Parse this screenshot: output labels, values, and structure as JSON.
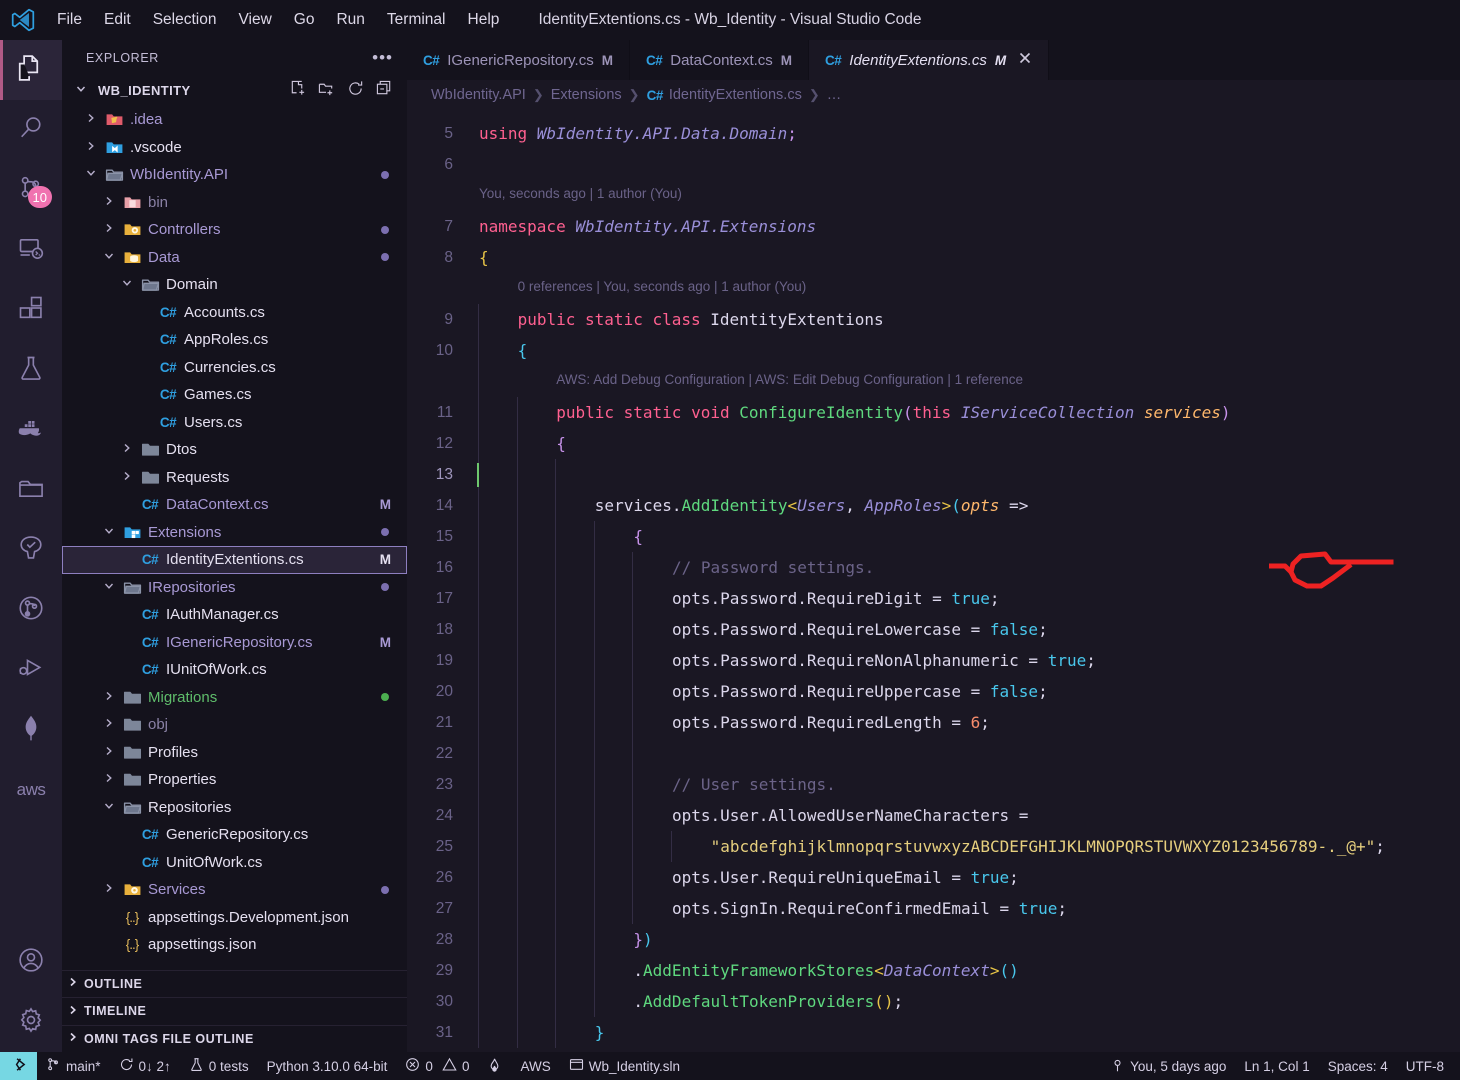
{
  "titlebar": {
    "logo_icon": "vscode-logo-icon",
    "window_title": "IdentityExtentions.cs - Wb_Identity - Visual Studio Code",
    "menu": [
      "File",
      "Edit",
      "Selection",
      "View",
      "Go",
      "Run",
      "Terminal",
      "Help"
    ]
  },
  "activitybar": {
    "items": [
      {
        "name": "explorer",
        "icon": "files-icon",
        "active": true,
        "badge": ""
      },
      {
        "name": "search",
        "icon": "search-icon",
        "active": false,
        "badge": ""
      },
      {
        "name": "source-control",
        "icon": "source-control-icon",
        "active": false,
        "badge": "10"
      },
      {
        "name": "remote-explorer",
        "icon": "remote-explorer-icon",
        "active": false,
        "badge": ""
      },
      {
        "name": "extensions",
        "icon": "extensions-icon",
        "active": false,
        "badge": ""
      },
      {
        "name": "testing",
        "icon": "beaker-icon",
        "active": false,
        "badge": ""
      },
      {
        "name": "docker",
        "icon": "docker-whale-icon",
        "active": false,
        "badge": ""
      },
      {
        "name": "project-manager",
        "icon": "folder-icon",
        "active": false,
        "badge": ""
      },
      {
        "name": "nx-console",
        "icon": "tree-check-icon",
        "active": false,
        "badge": ""
      },
      {
        "name": "git-graph",
        "icon": "git-graph-icon",
        "active": false,
        "badge": ""
      },
      {
        "name": "run-and-debug",
        "icon": "run-debug-icon",
        "active": false,
        "badge": ""
      },
      {
        "name": "mongodb",
        "icon": "mongodb-leaf-icon",
        "active": false,
        "badge": ""
      },
      {
        "name": "aws-toolkit",
        "icon": "aws-text-icon",
        "active": false,
        "badge": ""
      }
    ],
    "bottom_items": [
      {
        "name": "accounts",
        "icon": "account-icon"
      },
      {
        "name": "manage",
        "icon": "gear-icon"
      }
    ]
  },
  "sidebar": {
    "title": "EXPLORER",
    "more_actions_icon": "ellipsis-icon",
    "root": {
      "label": "WB_IDENTITY",
      "expanded": true,
      "actions": [
        "new-file-icon",
        "new-folder-icon",
        "refresh-icon",
        "collapse-all-icon"
      ]
    },
    "tree": [
      {
        "label": ".idea",
        "depth": 1,
        "type": "folder",
        "expanded": false,
        "icon": "folder-idea-icon",
        "color": "mod",
        "status": ""
      },
      {
        "label": ".vscode",
        "depth": 1,
        "type": "folder",
        "expanded": false,
        "icon": "folder-vscode-icon",
        "color": "plain",
        "status": ""
      },
      {
        "label": "WbIdentity.API",
        "depth": 1,
        "type": "folder",
        "expanded": true,
        "icon": "folder-open-icon",
        "color": "mod",
        "status": "dot-mod"
      },
      {
        "label": "bin",
        "depth": 2,
        "type": "folder",
        "expanded": false,
        "icon": "folder-bin-icon",
        "color": "ign",
        "status": ""
      },
      {
        "label": "Controllers",
        "depth": 2,
        "type": "folder",
        "expanded": false,
        "icon": "folder-controllers-icon",
        "color": "mod",
        "status": "dot-mod"
      },
      {
        "label": "Data",
        "depth": 2,
        "type": "folder",
        "expanded": true,
        "icon": "folder-data-icon",
        "color": "mod",
        "status": "dot-mod"
      },
      {
        "label": "Domain",
        "depth": 3,
        "type": "folder",
        "expanded": true,
        "icon": "folder-open-icon",
        "color": "plain",
        "status": ""
      },
      {
        "label": "Accounts.cs",
        "depth": 4,
        "type": "cs",
        "expanded": null,
        "icon": "csharp-icon",
        "color": "plain",
        "status": ""
      },
      {
        "label": "AppRoles.cs",
        "depth": 4,
        "type": "cs",
        "expanded": null,
        "icon": "csharp-icon",
        "color": "plain",
        "status": ""
      },
      {
        "label": "Currencies.cs",
        "depth": 4,
        "type": "cs",
        "expanded": null,
        "icon": "csharp-icon",
        "color": "plain",
        "status": ""
      },
      {
        "label": "Games.cs",
        "depth": 4,
        "type": "cs",
        "expanded": null,
        "icon": "csharp-icon",
        "color": "plain",
        "status": ""
      },
      {
        "label": "Users.cs",
        "depth": 4,
        "type": "cs",
        "expanded": null,
        "icon": "csharp-icon",
        "color": "plain",
        "status": ""
      },
      {
        "label": "Dtos",
        "depth": 3,
        "type": "folder",
        "expanded": false,
        "icon": "folder-icon",
        "color": "plain",
        "status": ""
      },
      {
        "label": "Requests",
        "depth": 3,
        "type": "folder",
        "expanded": false,
        "icon": "folder-icon",
        "color": "plain",
        "status": ""
      },
      {
        "label": "DataContext.cs",
        "depth": 3,
        "type": "cs",
        "expanded": null,
        "icon": "csharp-icon",
        "color": "mod",
        "status": "M"
      },
      {
        "label": "Extensions",
        "depth": 2,
        "type": "folder",
        "expanded": true,
        "icon": "folder-extensions-icon",
        "color": "mod",
        "status": "dot-mod"
      },
      {
        "label": "IdentityExtentions.cs",
        "depth": 3,
        "type": "cs",
        "expanded": null,
        "icon": "csharp-icon",
        "color": "plain",
        "status": "M",
        "selected": true
      },
      {
        "label": "IRepositories",
        "depth": 2,
        "type": "folder",
        "expanded": true,
        "icon": "folder-open-icon",
        "color": "mod",
        "status": "dot-mod"
      },
      {
        "label": "IAuthManager.cs",
        "depth": 3,
        "type": "cs",
        "expanded": null,
        "icon": "csharp-icon",
        "color": "plain",
        "status": ""
      },
      {
        "label": "IGenericRepository.cs",
        "depth": 3,
        "type": "cs",
        "expanded": null,
        "icon": "csharp-icon",
        "color": "mod",
        "status": "M"
      },
      {
        "label": "IUnitOfWork.cs",
        "depth": 3,
        "type": "cs",
        "expanded": null,
        "icon": "csharp-icon",
        "color": "plain",
        "status": ""
      },
      {
        "label": "Migrations",
        "depth": 2,
        "type": "folder",
        "expanded": false,
        "icon": "folder-icon",
        "color": "untr",
        "status": "dot-untr"
      },
      {
        "label": "obj",
        "depth": 2,
        "type": "folder",
        "expanded": false,
        "icon": "folder-icon",
        "color": "ign",
        "status": ""
      },
      {
        "label": "Profiles",
        "depth": 2,
        "type": "folder",
        "expanded": false,
        "icon": "folder-icon",
        "color": "plain",
        "status": ""
      },
      {
        "label": "Properties",
        "depth": 2,
        "type": "folder",
        "expanded": false,
        "icon": "folder-icon",
        "color": "plain",
        "status": ""
      },
      {
        "label": "Repositories",
        "depth": 2,
        "type": "folder",
        "expanded": true,
        "icon": "folder-open-icon",
        "color": "plain",
        "status": ""
      },
      {
        "label": "GenericRepository.cs",
        "depth": 3,
        "type": "cs",
        "expanded": null,
        "icon": "csharp-icon",
        "color": "plain",
        "status": ""
      },
      {
        "label": "UnitOfWork.cs",
        "depth": 3,
        "type": "cs",
        "expanded": null,
        "icon": "csharp-icon",
        "color": "plain",
        "status": ""
      },
      {
        "label": "Services",
        "depth": 2,
        "type": "folder",
        "expanded": false,
        "icon": "folder-services-icon",
        "color": "mod",
        "status": "dot-mod"
      },
      {
        "label": "appsettings.Development.json",
        "depth": 2,
        "type": "json",
        "expanded": null,
        "icon": "json-icon",
        "color": "plain",
        "status": ""
      },
      {
        "label": "appsettings.json",
        "depth": 2,
        "type": "json",
        "expanded": null,
        "icon": "json-icon",
        "color": "plain",
        "status": ""
      }
    ],
    "panels": [
      {
        "label": "OUTLINE",
        "expanded": false
      },
      {
        "label": "TIMELINE",
        "expanded": false
      },
      {
        "label": "OMNI TAGS FILE OUTLINE",
        "expanded": false
      }
    ]
  },
  "editor": {
    "tabs": [
      {
        "label": "IGenericRepository.cs",
        "icon": "csharp-icon",
        "dirty": "M",
        "active": false,
        "closable": false
      },
      {
        "label": "DataContext.cs",
        "icon": "csharp-icon",
        "dirty": "M",
        "active": false,
        "closable": false
      },
      {
        "label": "IdentityExtentions.cs",
        "icon": "csharp-icon",
        "dirty": "M",
        "active": true,
        "closable": true,
        "close_icon": "close-icon"
      }
    ],
    "breadcrumbs": [
      {
        "label": "WbIdentity.API",
        "icon": ""
      },
      {
        "label": "Extensions",
        "icon": ""
      },
      {
        "label": "IdentityExtentions.cs",
        "icon": "csharp-icon"
      },
      {
        "label": "…",
        "icon": ""
      }
    ],
    "codelens": [
      {
        "line": 7,
        "indent": 0,
        "text": "You, seconds ago | 1 author (You)"
      },
      {
        "line": 9,
        "indent": 1,
        "text": "0 references | You, seconds ago | 1 author (You)"
      },
      {
        "line": 11,
        "indent": 2,
        "text": "AWS: Add Debug Configuration | AWS: Edit Debug Configuration | 1 reference"
      }
    ],
    "cursor_line": 13,
    "annotation": {
      "name": "red-scribble-annotation",
      "color": "#ee2222"
    },
    "lines": [
      {
        "n": 5,
        "indent": 0,
        "tokens": [
          [
            "t-kw",
            "using "
          ],
          [
            "t-type",
            "WbIdentity.API.Data.Domain"
          ],
          [
            "t-brace3",
            ";"
          ]
        ]
      },
      {
        "n": 6,
        "indent": 0,
        "tokens": []
      },
      {
        "n": 7,
        "indent": 0,
        "tokens": [
          [
            "t-kw",
            "namespace "
          ],
          [
            "t-type",
            "WbIdentity.API.Extensions"
          ]
        ]
      },
      {
        "n": 8,
        "indent": 0,
        "tokens": [
          [
            "t-brace1",
            "{"
          ]
        ]
      },
      {
        "n": 9,
        "indent": 1,
        "tokens": [
          [
            "t-kw",
            "public "
          ],
          [
            "t-kw",
            "static "
          ],
          [
            "t-kw",
            "class "
          ],
          [
            "t-id",
            "IdentityExtentions"
          ]
        ]
      },
      {
        "n": 10,
        "indent": 1,
        "tokens": [
          [
            "t-brace2",
            "{"
          ]
        ]
      },
      {
        "n": 11,
        "indent": 2,
        "tokens": [
          [
            "t-kw",
            "public "
          ],
          [
            "t-kw",
            "static "
          ],
          [
            "t-kw2",
            "void "
          ],
          [
            "t-fn",
            "ConfigureIdentity"
          ],
          [
            "t-brace3",
            "("
          ],
          [
            "t-kw",
            "this "
          ],
          [
            "t-type",
            "IServiceCollection "
          ],
          [
            "t-param",
            "services"
          ],
          [
            "t-brace3",
            ")"
          ]
        ]
      },
      {
        "n": 12,
        "indent": 2,
        "tokens": [
          [
            "t-brace3",
            "{"
          ]
        ]
      },
      {
        "n": 13,
        "indent": 3,
        "tokens": []
      },
      {
        "n": 14,
        "indent": 3,
        "tokens": [
          [
            "t-id",
            "services"
          ],
          [
            "t-op",
            "."
          ],
          [
            "t-fn",
            "AddIdentity"
          ],
          [
            "t-brace1",
            "<"
          ],
          [
            "t-type",
            "Users"
          ],
          [
            "t-op",
            ", "
          ],
          [
            "t-type",
            "AppRoles"
          ],
          [
            "t-brace1",
            ">"
          ],
          [
            "t-brace2",
            "("
          ],
          [
            "t-param",
            "opts"
          ],
          [
            "t-op",
            " =>"
          ]
        ]
      },
      {
        "n": 15,
        "indent": 4,
        "tokens": [
          [
            "t-brace3",
            "{"
          ]
        ]
      },
      {
        "n": 16,
        "indent": 5,
        "tokens": [
          [
            "t-com",
            "// Password settings."
          ]
        ]
      },
      {
        "n": 17,
        "indent": 5,
        "tokens": [
          [
            "t-id",
            "opts.Password.RequireDigit"
          ],
          [
            "t-op",
            " = "
          ],
          [
            "t-bool",
            "true"
          ],
          [
            "t-op",
            ";"
          ]
        ]
      },
      {
        "n": 18,
        "indent": 5,
        "tokens": [
          [
            "t-id",
            "opts.Password.RequireLowercase"
          ],
          [
            "t-op",
            " = "
          ],
          [
            "t-bool",
            "false"
          ],
          [
            "t-op",
            ";"
          ]
        ]
      },
      {
        "n": 19,
        "indent": 5,
        "tokens": [
          [
            "t-id",
            "opts.Password.RequireNonAlphanumeric"
          ],
          [
            "t-op",
            " = "
          ],
          [
            "t-bool",
            "true"
          ],
          [
            "t-op",
            ";"
          ]
        ]
      },
      {
        "n": 20,
        "indent": 5,
        "tokens": [
          [
            "t-id",
            "opts.Password.RequireUppercase"
          ],
          [
            "t-op",
            " = "
          ],
          [
            "t-bool",
            "false"
          ],
          [
            "t-op",
            ";"
          ]
        ]
      },
      {
        "n": 21,
        "indent": 5,
        "tokens": [
          [
            "t-id",
            "opts.Password.RequiredLength"
          ],
          [
            "t-op",
            " = "
          ],
          [
            "t-num",
            "6"
          ],
          [
            "t-op",
            ";"
          ]
        ]
      },
      {
        "n": 22,
        "indent": 5,
        "tokens": []
      },
      {
        "n": 23,
        "indent": 5,
        "tokens": [
          [
            "t-com",
            "// User settings."
          ]
        ]
      },
      {
        "n": 24,
        "indent": 5,
        "tokens": [
          [
            "t-id",
            "opts.User.AllowedUserNameCharacters"
          ],
          [
            "t-op",
            " ="
          ]
        ]
      },
      {
        "n": 25,
        "indent": 6,
        "tokens": [
          [
            "t-str",
            "\"abcdefghijklmnopqrstuvwxyzABCDEFGHIJKLMNOPQRSTUVWXYZ0123456789-._@+\""
          ],
          [
            "t-op",
            ";"
          ]
        ]
      },
      {
        "n": 26,
        "indent": 5,
        "tokens": [
          [
            "t-id",
            "opts.User.RequireUniqueEmail"
          ],
          [
            "t-op",
            " = "
          ],
          [
            "t-bool",
            "true"
          ],
          [
            "t-op",
            ";"
          ]
        ]
      },
      {
        "n": 27,
        "indent": 5,
        "tokens": [
          [
            "t-id",
            "opts.SignIn.RequireConfirmedEmail"
          ],
          [
            "t-op",
            " = "
          ],
          [
            "t-bool",
            "true"
          ],
          [
            "t-op",
            ";"
          ]
        ]
      },
      {
        "n": 28,
        "indent": 4,
        "tokens": [
          [
            "t-brace3",
            "}"
          ],
          [
            "t-brace2",
            ")"
          ]
        ]
      },
      {
        "n": 29,
        "indent": 4,
        "tokens": [
          [
            "t-op",
            "."
          ],
          [
            "t-fn",
            "AddEntityFrameworkStores"
          ],
          [
            "t-brace1",
            "<"
          ],
          [
            "t-type",
            "DataContext"
          ],
          [
            "t-brace1",
            ">"
          ],
          [
            "t-brace2",
            "()"
          ]
        ]
      },
      {
        "n": 30,
        "indent": 4,
        "tokens": [
          [
            "t-op",
            "."
          ],
          [
            "t-fn",
            "AddDefaultTokenProviders"
          ],
          [
            "t-brace1",
            "()"
          ],
          [
            "t-op",
            ";"
          ]
        ]
      },
      {
        "n": 31,
        "indent": 3,
        "tokens": [
          [
            "t-brace2",
            "}"
          ]
        ]
      }
    ]
  },
  "statusbar": {
    "remote": {
      "icon": "remote-window-icon",
      "label": ""
    },
    "left": [
      {
        "name": "branch",
        "icon": "source-control-icon",
        "label": "main*"
      },
      {
        "name": "sync-changes",
        "icon": "sync-icon",
        "label": "0↓ 2↑"
      },
      {
        "name": "tests",
        "icon": "beaker-icon",
        "label": "0 tests"
      },
      {
        "name": "python-version",
        "icon": "",
        "label": "Python 3.10.0 64-bit"
      },
      {
        "name": "problems",
        "icon": "error-warning-icon",
        "label": "0  0"
      },
      {
        "name": "flame",
        "icon": "flame-icon",
        "label": ""
      },
      {
        "name": "aws-profile",
        "icon": "",
        "label": "AWS"
      },
      {
        "name": "solution",
        "icon": "window-icon",
        "label": "Wb_Identity.sln"
      }
    ],
    "right": [
      {
        "name": "git-blame",
        "icon": "git-commit-icon",
        "label": "You, 5 days ago"
      },
      {
        "name": "cursor-pos",
        "icon": "",
        "label": "Ln 1, Col 1"
      },
      {
        "name": "indentation",
        "icon": "",
        "label": "Spaces: 4"
      },
      {
        "name": "encoding",
        "icon": "",
        "label": "UTF-8"
      }
    ],
    "problems": {
      "errors": "0",
      "warnings": "0"
    }
  }
}
